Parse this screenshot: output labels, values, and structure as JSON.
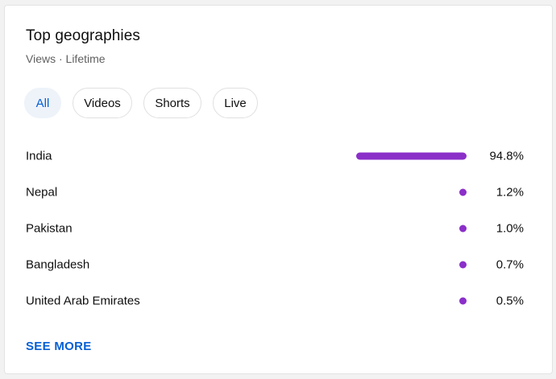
{
  "card": {
    "title": "Top geographies",
    "subtitle": "Views · Lifetime"
  },
  "chips": [
    {
      "label": "All",
      "active": true
    },
    {
      "label": "Videos",
      "active": false
    },
    {
      "label": "Shorts",
      "active": false
    },
    {
      "label": "Live",
      "active": false
    }
  ],
  "colors": {
    "bar": "#8b2fc9",
    "accent": "#065fd4"
  },
  "geographies": [
    {
      "name": "India",
      "percent_label": "94.8%",
      "value": 94.8
    },
    {
      "name": "Nepal",
      "percent_label": "1.2%",
      "value": 1.2
    },
    {
      "name": "Pakistan",
      "percent_label": "1.0%",
      "value": 1.0
    },
    {
      "name": "Bangladesh",
      "percent_label": "0.7%",
      "value": 0.7
    },
    {
      "name": "United Arab Emirates",
      "percent_label": "0.5%",
      "value": 0.5
    }
  ],
  "see_more_label": "SEE MORE"
}
